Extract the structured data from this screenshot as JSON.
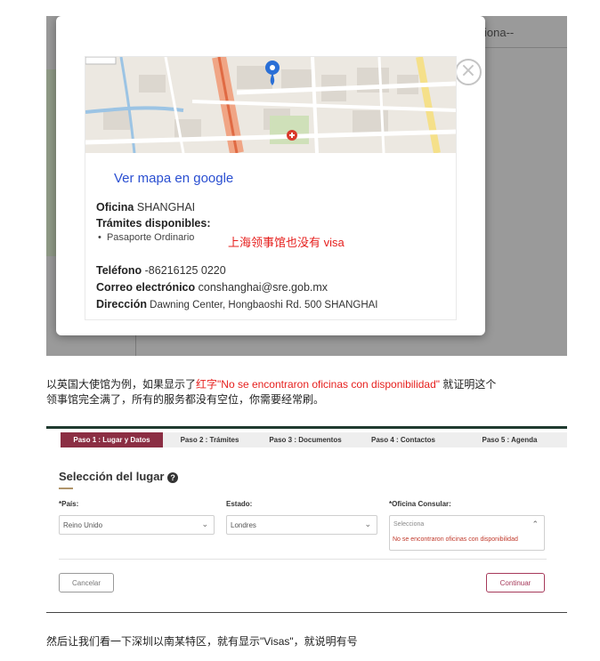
{
  "modal_screenshot": {
    "background": {
      "header_text": "iona--"
    },
    "maps_link": "Ver mapa en google",
    "office_label": "Oficina",
    "office_value": "SHANGHAI",
    "procedures_label": "Trámites disponibles:",
    "procedures": [
      "Pasaporte Ordinario"
    ],
    "annotation_red": "上海领事馆也没有 visa",
    "phone_label": "Teléfono",
    "phone_value": "-86216125 0220",
    "email_label": "Correo electrónico",
    "email_value": "conshanghai@sre.gob.mx",
    "address_label": "Dirección",
    "address_value": "Dawning Center, Hongbaoshi Rd. 500 SHANGHAI",
    "close_icon": "close-icon"
  },
  "paragraph1": {
    "before": "以英国大使馆为例，如果显示了",
    "red": "红字\"No se encontraron oficinas con disponibilidad\"",
    "after": " 就证明这个",
    "line2": "领事馆完全满了，所有的服务都没有空位，你需要经常刷。"
  },
  "form_screenshot": {
    "steps": [
      {
        "label": "Paso 1 : Lugar y Datos"
      },
      {
        "label": "Paso 2 : Trámites"
      },
      {
        "label": "Paso 3 : Documentos"
      },
      {
        "label": "Paso 4 : Contactos"
      },
      {
        "label": "Paso 5 : Agenda"
      }
    ],
    "title": "Selección del lugar",
    "country_label": "*País:",
    "country_value": "Reino Unido",
    "state_label": "Estado:",
    "state_value": "Londres",
    "office_label": "*Oficina Consular:",
    "office_placeholder": "Selecciona",
    "office_error": "No se encontraron oficinas con disponibilidad",
    "cancel_label": "Cancelar",
    "continue_label": "Continuar",
    "colors": {
      "active_step": "#8b2e43",
      "accent": "#a6395a",
      "error": "#c0392b"
    }
  },
  "paragraph2": {
    "text": "然后让我们看一下深圳以南某特区，就有显示\"Visas\"，就说明有号"
  }
}
